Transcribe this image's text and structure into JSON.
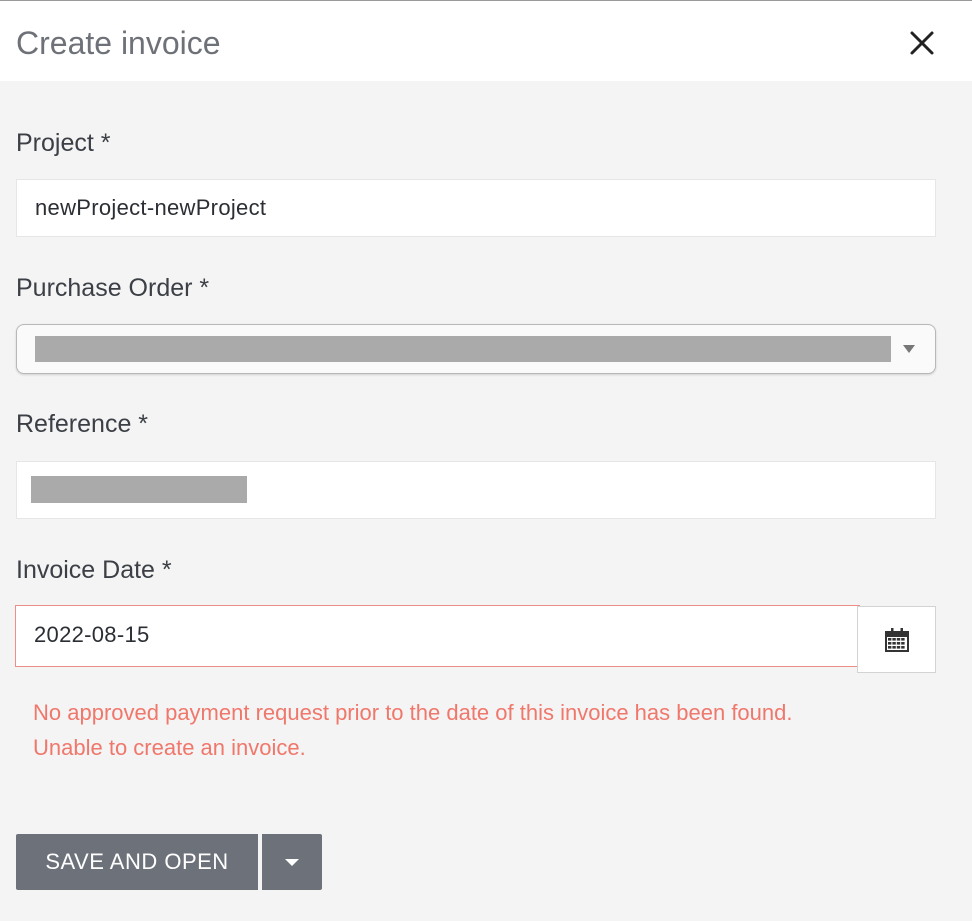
{
  "dialog": {
    "title": "Create invoice",
    "close_icon": "close-icon"
  },
  "form": {
    "project": {
      "label": "Project *",
      "value": "newProject-newProject"
    },
    "purchase_order": {
      "label": "Purchase Order *",
      "value_redacted": true,
      "icon": "chevron-down-icon"
    },
    "reference": {
      "label": "Reference *",
      "value_redacted": true
    },
    "invoice_date": {
      "label": "Invoice Date *",
      "value": "2022-08-15",
      "icon": "calendar-icon"
    },
    "error": {
      "line1": "No approved payment request prior to the date of this invoice has been found.",
      "line2": "Unable to create an invoice."
    }
  },
  "actions": {
    "save_label": "SAVE AND OPEN",
    "split_icon": "chevron-down-icon"
  },
  "colors": {
    "error": "#f0776b",
    "button_bg": "#6d727a",
    "panel_bg": "#f4f4f4"
  }
}
